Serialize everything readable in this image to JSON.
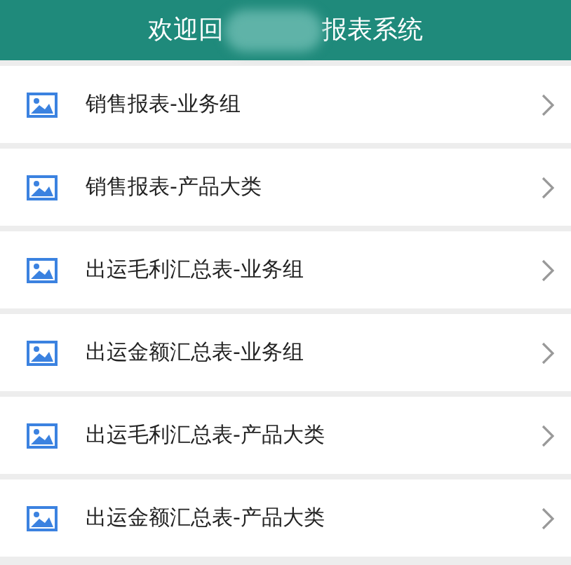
{
  "header": {
    "title_parts": [
      "欢迎回",
      "报表系统"
    ]
  },
  "items": [
    {
      "label": "销售报表-业务组"
    },
    {
      "label": "销售报表-产品大类"
    },
    {
      "label": "出运毛利汇总表-业务组"
    },
    {
      "label": "出运金额汇总表-业务组"
    },
    {
      "label": "出运毛利汇总表-产品大类"
    },
    {
      "label": "出运金额汇总表-产品大类"
    }
  ]
}
